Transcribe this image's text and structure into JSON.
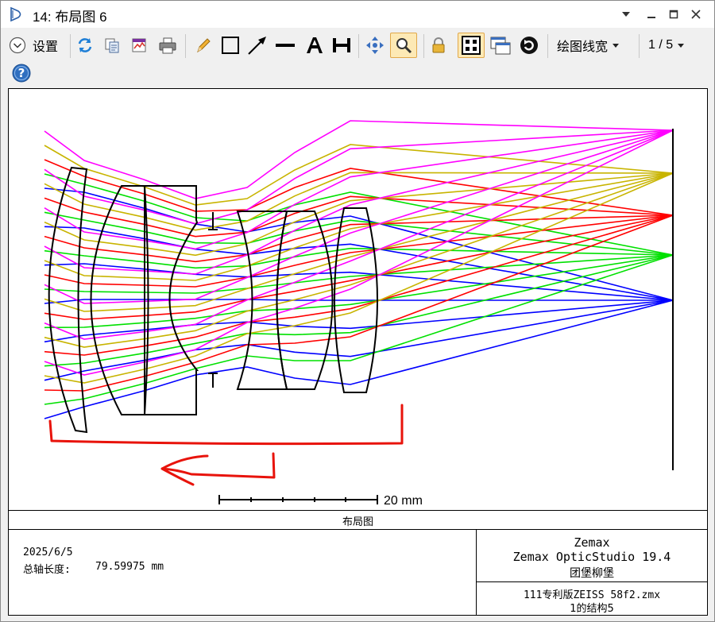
{
  "window": {
    "title": "14: 布局图 6"
  },
  "toolbar": {
    "settings_label": "设置",
    "line_width_label": "绘图线宽",
    "page_indicator": "1 / 5",
    "icons": [
      "refresh-icon",
      "copy-icon",
      "export-icon",
      "print-icon",
      "pencil-icon",
      "rectangle-icon",
      "arrow-icon",
      "line-icon",
      "text-icon",
      "dimension-icon",
      "pan-icon",
      "zoom-icon",
      "lock-icon",
      "grid-icon",
      "window-icon",
      "rotate-icon",
      "help-icon"
    ]
  },
  "plot": {
    "scale_label": "20 mm",
    "panel_title": "布局图",
    "date": "2025/6/5",
    "axis_length_label": "总轴长度:",
    "axis_length_value": "79.59975 mm",
    "vendor": "Zemax",
    "product": "Zemax OpticStudio 19.4",
    "author": "团堡柳堡",
    "filename": "111专利版ZEISS 58f2.zmx",
    "config": "1的结构5",
    "ray_colors": [
      "#0000ff",
      "#00e000",
      "#ff0000",
      "#c8b400",
      "#ff00ff"
    ],
    "annotation_color": "#e8130b"
  }
}
